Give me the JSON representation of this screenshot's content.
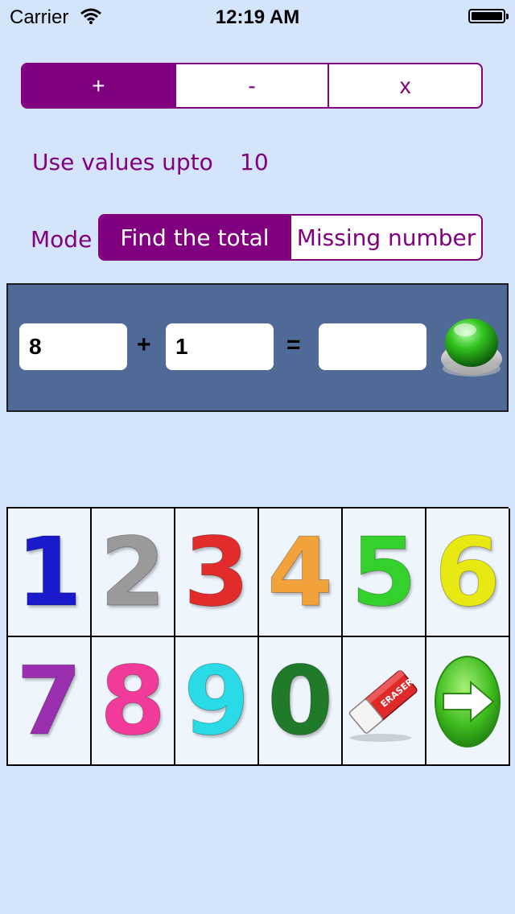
{
  "status_bar": {
    "carrier": "Carrier",
    "time": "12:19 AM"
  },
  "operations": {
    "items": [
      "+",
      "-",
      "x"
    ],
    "selected_index": 0
  },
  "range": {
    "label": "Use values upto",
    "value": "10"
  },
  "mode": {
    "label": "Mode",
    "options": [
      "Find the total",
      "Missing number"
    ],
    "selected_index": 0
  },
  "equation": {
    "first": "8",
    "operator": "+",
    "second": "1",
    "equals": "=",
    "answer": ""
  },
  "keypad": {
    "digits": [
      {
        "label": "1",
        "color": "#1a1acc"
      },
      {
        "label": "2",
        "color": "#9a9a9a"
      },
      {
        "label": "3",
        "color": "#e22b2b"
      },
      {
        "label": "4",
        "color": "#f2a23a"
      },
      {
        "label": "5",
        "color": "#34d02c"
      },
      {
        "label": "6",
        "color": "#e8e812"
      },
      {
        "label": "7",
        "color": "#9a2fb0"
      },
      {
        "label": "8",
        "color": "#f13a9a"
      },
      {
        "label": "9",
        "color": "#29dbe6"
      },
      {
        "label": "0",
        "color": "#1f7a2a"
      }
    ],
    "eraser_label": "ERASER",
    "icons": [
      "eraser-icon",
      "next-arrow-icon"
    ]
  },
  "colors": {
    "accent": "#800080",
    "background": "#d3e4fb",
    "panel": "#506a98"
  }
}
